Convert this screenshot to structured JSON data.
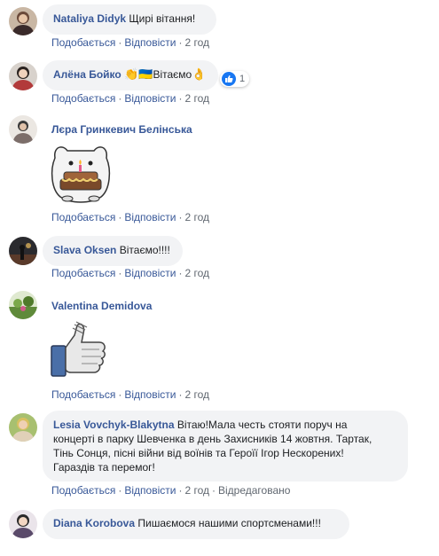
{
  "actions": {
    "like": "Подобається",
    "reply": "Відповісти",
    "edited": "Відредаговано",
    "separator": "·"
  },
  "comments": [
    {
      "author": "Nataliya Didyk",
      "text": "Щирі вітання!",
      "time": "2 год"
    },
    {
      "author": "Алёна Бойко",
      "emoji_before": "👏🇺🇦",
      "text": "Вітаємо",
      "emoji_after": "👌",
      "reaction_count": "1",
      "time": "2 год"
    },
    {
      "author": "Лєра Гринкевич Белінська",
      "sticker": "birthday-cake-bear-sticker",
      "time": "2 год"
    },
    {
      "author": "Slava Oksen",
      "text": "Вітаємо!!!!",
      "time": "2 год"
    },
    {
      "author": "Valentina Demidova",
      "sticker": "thumbs-up-sticker",
      "time": "2 год"
    },
    {
      "author": "Lesia Vovchyk-Blakytna",
      "text_line1": "Вітаю!Мала честь стояти поруч на",
      "text_line2": "концерті в парку Шевченка в день Захисників 14 жовтня. Тартак,",
      "text_line3": "Тінь Сонця, пісні війни від воїнів та Героїї Ігор Нескорених!",
      "text_line4": "Гараздів та перемог!",
      "time": "2 год",
      "edited": true
    },
    {
      "author": "Diana Korobova",
      "text": "Пишаємося нашими спортсменами!!!"
    }
  ],
  "colors": {
    "name": "#385898",
    "bubble": "#f2f3f5",
    "meta": "#606770",
    "like_blue": "#1877f2"
  }
}
